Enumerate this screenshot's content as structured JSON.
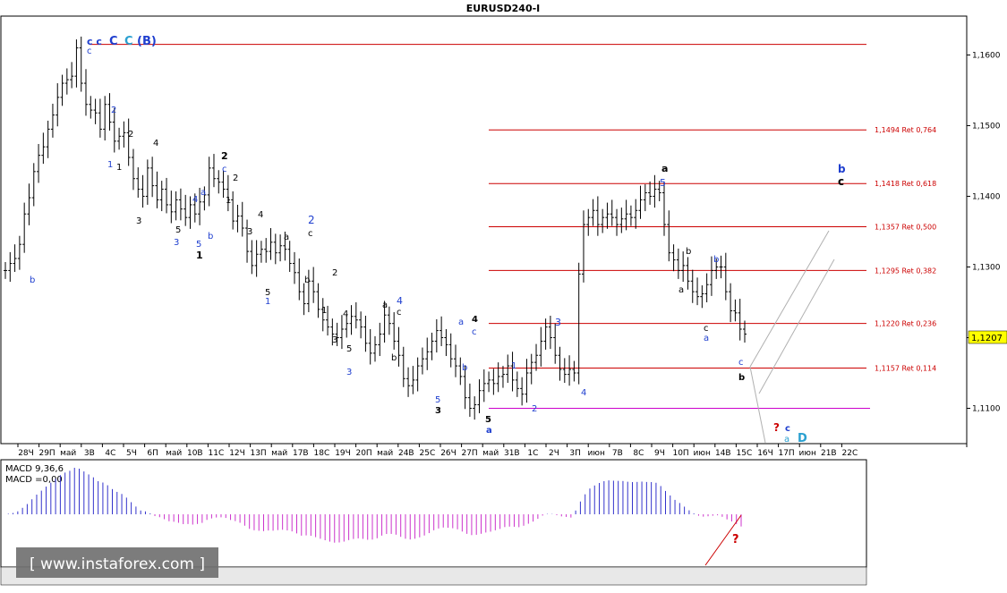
{
  "chart_data": {
    "type": "ohlc",
    "symbol_title": "EURUSD240-I",
    "y_axis": {
      "ylim": [
        1.105,
        1.1655
      ],
      "ticks": [
        "1,1600",
        "1,1500",
        "1,1400",
        "1,1300",
        "1,1200",
        "1,1100"
      ],
      "tick_values": [
        1.16,
        1.15,
        1.14,
        1.13,
        1.12,
        1.11
      ],
      "current_price_label": "1,1207",
      "current_price": 1.1207
    },
    "x_axis": {
      "tick_labels": [
        "28Ч",
        "29П",
        "май",
        "3В",
        "4С",
        "5Ч",
        "6П",
        "май",
        "10В",
        "11С",
        "12Ч",
        "13П",
        "май",
        "17В",
        "18С",
        "19Ч",
        "20П",
        "май",
        "24В",
        "25С",
        "26Ч",
        "27П",
        "май",
        "31В",
        "1С",
        "2Ч",
        "3П",
        "июн",
        "7В",
        "8С",
        "9Ч",
        "10П",
        "июн",
        "14В",
        "15С",
        "16Ч",
        "17П",
        "июн",
        "21В",
        "22С"
      ]
    },
    "closes": [
      1.1295,
      1.1305,
      1.1312,
      1.1332,
      1.1375,
      1.1398,
      1.1435,
      1.1458,
      1.147,
      1.1495,
      1.1515,
      1.154,
      1.156,
      1.1565,
      1.157,
      1.161,
      1.156,
      1.153,
      1.1522,
      1.1518,
      1.1495,
      1.153,
      1.1505,
      1.1478,
      1.1485,
      1.149,
      1.1455,
      1.1425,
      1.141,
      1.14,
      1.144,
      1.1415,
      1.1395,
      1.141,
      1.1388,
      1.1378,
      1.1395,
      1.1382,
      1.137,
      1.1388,
      1.1375,
      1.1392,
      1.1402,
      1.144,
      1.1425,
      1.142,
      1.141,
      1.1395,
      1.1365,
      1.1372,
      1.1355,
      1.1322,
      1.1302,
      1.1318,
      1.1325,
      1.1322,
      1.1335,
      1.132,
      1.133,
      1.1325,
      1.1305,
      1.1292,
      1.1265,
      1.1248,
      1.128,
      1.1265,
      1.124,
      1.1225,
      1.1215,
      1.1205,
      1.12,
      1.1212,
      1.122,
      1.123,
      1.1225,
      1.1215,
      1.1192,
      1.1178,
      1.119,
      1.1205,
      1.1232,
      1.122,
      1.1195,
      1.1175,
      1.1142,
      1.1132,
      1.114,
      1.116,
      1.117,
      1.118,
      1.1195,
      1.121,
      1.12,
      1.119,
      1.117,
      1.116,
      1.1145,
      1.1115,
      1.11,
      1.1105,
      1.1125,
      1.1135,
      1.114,
      1.1135,
      1.1145,
      1.1148,
      1.116,
      1.114,
      1.1128,
      1.112,
      1.115,
      1.1165,
      1.1175,
      1.1195,
      1.1215,
      1.12,
      1.1175,
      1.1155,
      1.1148,
      1.1155,
      1.115,
      1.129,
      1.136,
      1.137,
      1.138,
      1.136,
      1.137,
      1.1375,
      1.137,
      1.136,
      1.1368,
      1.1375,
      1.137,
      1.138,
      1.1395,
      1.1405,
      1.14,
      1.141,
      1.1405,
      1.136,
      1.132,
      1.131,
      1.1295,
      1.1302,
      1.128,
      1.1265,
      1.1258,
      1.1262,
      1.1275,
      1.1295,
      1.13,
      1.13,
      1.1265,
      1.1238,
      1.1235,
      1.1212,
      1.1205
    ]
  },
  "labels": {
    "top_left_count": "c c",
    "top_C1": "C",
    "top_C2": "C",
    "top_B": "(B)",
    "c_under": "c",
    "w_2a": "2",
    "w_2b": "2",
    "w_1a": "1",
    "w_1b": "1",
    "w_b_first": "b",
    "w_4a": "4",
    "w_4b": "4",
    "w_a_1": "a",
    "w_5a": "5",
    "w_5b": "5",
    "w_3a": "3",
    "w_3b": "3",
    "w_b2": "b",
    "w_1c": "1",
    "w_2c": "2",
    "w_c1": "c",
    "w_1d": "1",
    "w_2d": "2",
    "w_3c": "3",
    "w_4c": "4",
    "w_2e": "2",
    "w_c2": "c",
    "w_a2": "a",
    "w_3d": "3",
    "w_5c": "5",
    "w_1e": "1",
    "w_b3": "b",
    "w_a3": "a",
    "w_2f": "2",
    "w_b4": "b",
    "w_1f": "1",
    "w_4d": "4",
    "w_3e": "3",
    "w_a4": "a",
    "w_3f": "3",
    "w_4e": "4",
    "w_c3": "c",
    "w_b5": "b",
    "w_5d": "5",
    "w_3g": "3",
    "w_a5": "a",
    "w_c4": "c",
    "w_4f": "4",
    "w_b6": "b",
    "w_5e": "5",
    "w_a6": "a",
    "w_1g": "1",
    "w_2g": "2",
    "w_3h": "3",
    "w_4g": "4",
    "w_a7": "a",
    "w_5f": "5",
    "w_b7": "b",
    "w_a8": "a",
    "w_b8": "b",
    "w_c5": "c",
    "w_a9": "a",
    "w_c6": "c",
    "w_b9": "b",
    "w_q1": "?",
    "w_c7": "c",
    "w_a10": "a",
    "w_D": "D",
    "w_b10": "b",
    "w_c8": "c"
  },
  "fib_levels": [
    {
      "label": "1,1494 Ret 0,764",
      "value": 1.1494
    },
    {
      "label": "1,1418 Ret 0,618",
      "value": 1.1418
    },
    {
      "label": "1,1357 Ret 0,500",
      "value": 1.1357
    },
    {
      "label": "1,1295 Ret 0,382",
      "value": 1.1295
    },
    {
      "label": "1,1220 Ret 0,236",
      "value": 1.122
    },
    {
      "label": "1,1157 Ret 0,114",
      "value": 1.1157
    }
  ],
  "macd_panel": {
    "label_line1": "MACD 9,36,6",
    "label_line2": "MACD =0,00",
    "question": "?"
  },
  "watermark": "[ www.instaforex.com ]",
  "colors": {
    "fib_line": "#cc0000",
    "support_line": "#cc00cc",
    "blue_label": "#1f3fcf",
    "macd_pos": "#3333cc",
    "macd_neg": "#cc33cc",
    "trend_channel": "#b0b0b0",
    "question": "#cc0000"
  }
}
